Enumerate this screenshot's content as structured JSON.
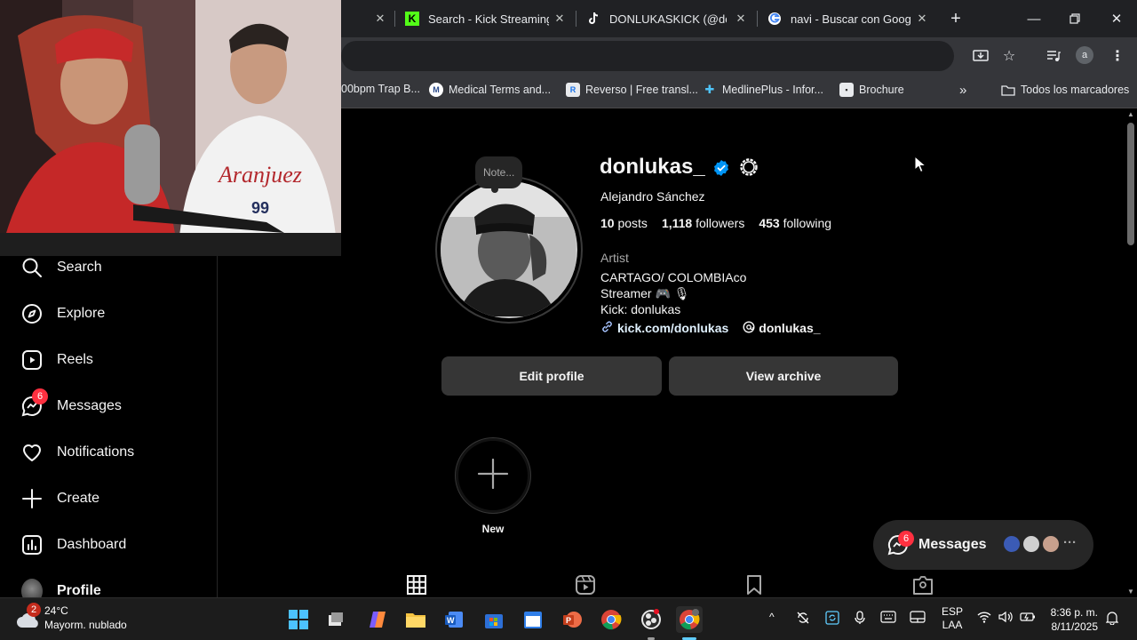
{
  "browser": {
    "tabs": [
      {
        "title": "Search - Kick Streaming",
        "favicon": "kick-icon"
      },
      {
        "title": "DONLUKASKICK (@donl",
        "favicon": "tiktok-icon"
      },
      {
        "title": "navi - Buscar con Google",
        "favicon": "google-icon"
      }
    ],
    "bookmarks": [
      {
        "label": "00bpm Trap B..."
      },
      {
        "label": "Medical Terms and...",
        "favicon": "mw-icon"
      },
      {
        "label": "Reverso | Free transl...",
        "favicon": "reverso-icon"
      },
      {
        "label": "MedlinePlus - Infor...",
        "favicon": "medlineplus-icon"
      },
      {
        "label": "Brochure",
        "favicon": "brochure-icon"
      }
    ],
    "all_bookmarks_label": "Todos los marcadores",
    "profile_initial": "a"
  },
  "sidebar": {
    "items": [
      {
        "label": "Search",
        "icon": "search-icon"
      },
      {
        "label": "Explore",
        "icon": "compass-icon"
      },
      {
        "label": "Reels",
        "icon": "reels-icon"
      },
      {
        "label": "Messages",
        "icon": "messenger-icon",
        "badge": "6"
      },
      {
        "label": "Notifications",
        "icon": "heart-icon"
      },
      {
        "label": "Create",
        "icon": "plus-icon"
      },
      {
        "label": "Dashboard",
        "icon": "dashboard-icon"
      },
      {
        "label": "Profile",
        "icon": "avatar"
      }
    ]
  },
  "profile": {
    "note": "Note...",
    "username": "donlukas_",
    "full_name": "Alejandro Sánchez",
    "stats": {
      "posts_count": "10",
      "posts_label": "posts",
      "followers_count": "1,118",
      "followers_label": "followers",
      "following_count": "453",
      "following_label": "following"
    },
    "category": "Artist",
    "bio_lines": [
      "CARTAGO/ COLOMBIAco",
      "Streamer 🎮 🎙",
      "Kick: donlukas"
    ],
    "link": "kick.com/donlukas",
    "threads_handle": "donlukas_",
    "edit_button": "Edit profile",
    "archive_button": "View archive",
    "highlight_new_label": "New"
  },
  "messages_pill": {
    "label": "Messages",
    "badge": "6"
  },
  "taskbar": {
    "weather_badge": "2",
    "temperature": "24°C",
    "condition": "Mayorm. nublado",
    "language": "ESP",
    "region": "LAA",
    "time": "8:36 p. m.",
    "date": "8/11/2025"
  },
  "colors": {
    "ig_badge_red": "#ff3040",
    "ig_button": "#363636",
    "chrome_tabbar": "#202124",
    "chrome_toolbar": "#35363a",
    "verified_blue": "#0095f6",
    "link_blue": "#e0f1ff"
  }
}
